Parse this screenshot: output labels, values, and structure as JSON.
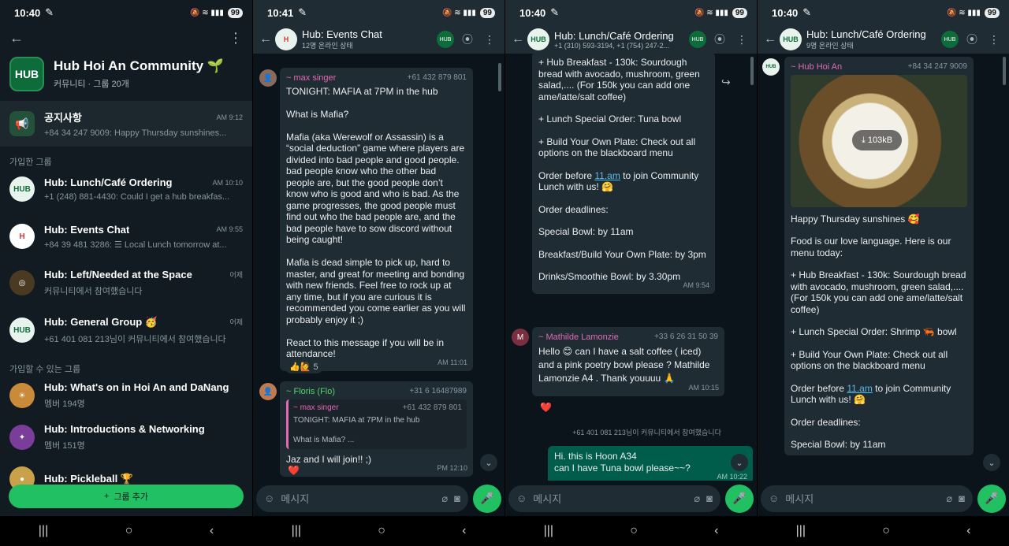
{
  "status": [
    {
      "time": "10:40",
      "battery": "99"
    },
    {
      "time": "10:41",
      "battery": "99"
    },
    {
      "time": "10:40",
      "battery": "99"
    },
    {
      "time": "10:40",
      "battery": "99"
    }
  ],
  "community": {
    "name": "Hub Hoi An Community 🌱",
    "meta": "커뮤니티 · 그룹 20개",
    "avatar_label": "HUB",
    "announcement": {
      "title": "공지사항",
      "time": "AM 9:12",
      "preview": "+84 34 247 9009: Happy Thursday sunshines..."
    },
    "joined_header": "가입한 그룹",
    "joined": [
      {
        "title": "Hub: Lunch/Café Ordering",
        "time": "AM 10:10",
        "preview": "+1 (248) 881-4430: Could I get a hub breakfas..."
      },
      {
        "title": "Hub: Events Chat",
        "time": "AM 9:55",
        "preview": "+84 39 481 3286: ☰ Local Lunch tomorrow at..."
      },
      {
        "title": "Hub: Left/Needed at the Space",
        "time": "어제",
        "preview": "커뮤니티에서 참여했습니다"
      },
      {
        "title": "Hub: General Group 🥳",
        "time": "어제",
        "preview": "+61 401 081 213님이 커뮤니티에서 참여했습니다"
      }
    ],
    "available_header": "가입할 수 있는 그룹",
    "available": [
      {
        "title": "Hub: What's on in Hoi An and DaNang",
        "members": "멤버 194명"
      },
      {
        "title": "Hub: Introductions & Networking",
        "members": "멤버 151명"
      },
      {
        "title": "Hub: Pickleball 🏆",
        "members": ""
      }
    ],
    "add_group": "그룹 추가"
  },
  "events_chat": {
    "title": "Hub: Events Chat",
    "subtitle": "12명 온라인 상태",
    "msg1": {
      "sender": "~ max singer",
      "number": "+61 432 879 801",
      "text": "TONIGHT: MAFIA at 7PM in the hub\n\nWhat is Mafia?\n\nMafia (aka Werewolf or Assassin) is a “social deduction” game where players are divided into bad people and good people. bad people know who the other bad people are, but the good people don’t know who is good and who is bad. As the game progresses, the good people must find out who the bad people are, and the bad people have to sow discord without being caught!\n\nMafia is dead simple to pick up, hard to master, and great for meeting and bonding with new friends. Feel free to rock up at any time, but if you are curious it is recommended you come earlier as you will probably enjoy it ;)\n\nReact to this message if you will be in attendance!",
      "time": "AM 11:01",
      "reactions": "👍🙋 5"
    },
    "msg2": {
      "sender": "~ Floris (Flo)",
      "number": "+31 6 16487989",
      "quote_sender": "~ max singer",
      "quote_number": "+61 432 879 801",
      "quote_line1": "TONIGHT: MAFIA at 7PM in the hub",
      "quote_line2": "What is Mafia? ...",
      "text": "Jaz and I will join!! ;)",
      "time": "PM 12:10",
      "reaction": "❤️"
    }
  },
  "lunch_chat": {
    "title": "Hub: Lunch/Café Ordering",
    "subtitle": "+1 (310) 593-3194, +1 (754) 247-2...",
    "msg1": {
      "p1": "+ Hub Breakfast - 130k: Sourdough bread with avocado, mushroom, green salad,.... (For 150k you can add one ame/latte/salt coffee)",
      "p2": "+ Lunch Special Order: Tuna bowl",
      "p3": "+ Build Your Own Plate: Check out all options on the blackboard menu",
      "p4_pre": "Order before ",
      "p4_link": "11.am",
      "p4_post": " to join Community Lunch with us! 🤗",
      "p5": "Order deadlines:",
      "p6": "Special Bowl: by 11am",
      "p7": "Breakfast/Build Your Own Plate: by 3pm",
      "p8": "Drinks/Smoothie Bowl: by 3.30pm",
      "time": "AM 9:54"
    },
    "msg2": {
      "avatar": "M",
      "sender": "~ Mathilde Lamonzie",
      "number": "+33 6 26 31 50 39",
      "text": "Hello 😊 can I have a salt coffee ( iced) and a pink poetry bowl please ? Mathilde Lamonzie A4 . Thank youuuu 🙏",
      "time": "AM 10:15",
      "reaction": "❤️"
    },
    "system": "+61 401 081 213님이 커뮤니티에서 참여했습니다",
    "msg3": {
      "text": "Hi. this is Hoon A34\ncan I have Tuna bowl please~~?",
      "time": "AM 10:22"
    }
  },
  "lunch_chat2": {
    "title": "Hub: Lunch/Café Ordering",
    "subtitle": "9명 온라인 상태",
    "msg": {
      "sender": "~ Hub Hoi An",
      "number": "+84 34 247 9009",
      "download": "103kB",
      "p1": "Happy Thursday sunshines 🥰",
      "p2": "Food is our love language. Here is our menu today:",
      "p3": "+ Hub Breakfast - 130k: Sourdough bread with avocado, mushroom, green salad,.... (For 150k you can add one ame/latte/salt coffee)",
      "p4": "+ Lunch Special Order: Shrimp 🦐 bowl",
      "p5": "+ Build Your Own Plate: Check out all options on the blackboard menu",
      "p6_pre": "Order before ",
      "p6_link": "11.am",
      "p6_post": " to join Community Lunch with us! 🤗",
      "p7": "Order deadlines:",
      "p8": "Special Bowl: by 11am"
    }
  },
  "composer": {
    "placeholder": "메시지"
  },
  "colors": {
    "accent": "#21c063",
    "bubble_in": "#1f2c34",
    "bubble_out": "#005c4b",
    "background": "#0b141a"
  }
}
